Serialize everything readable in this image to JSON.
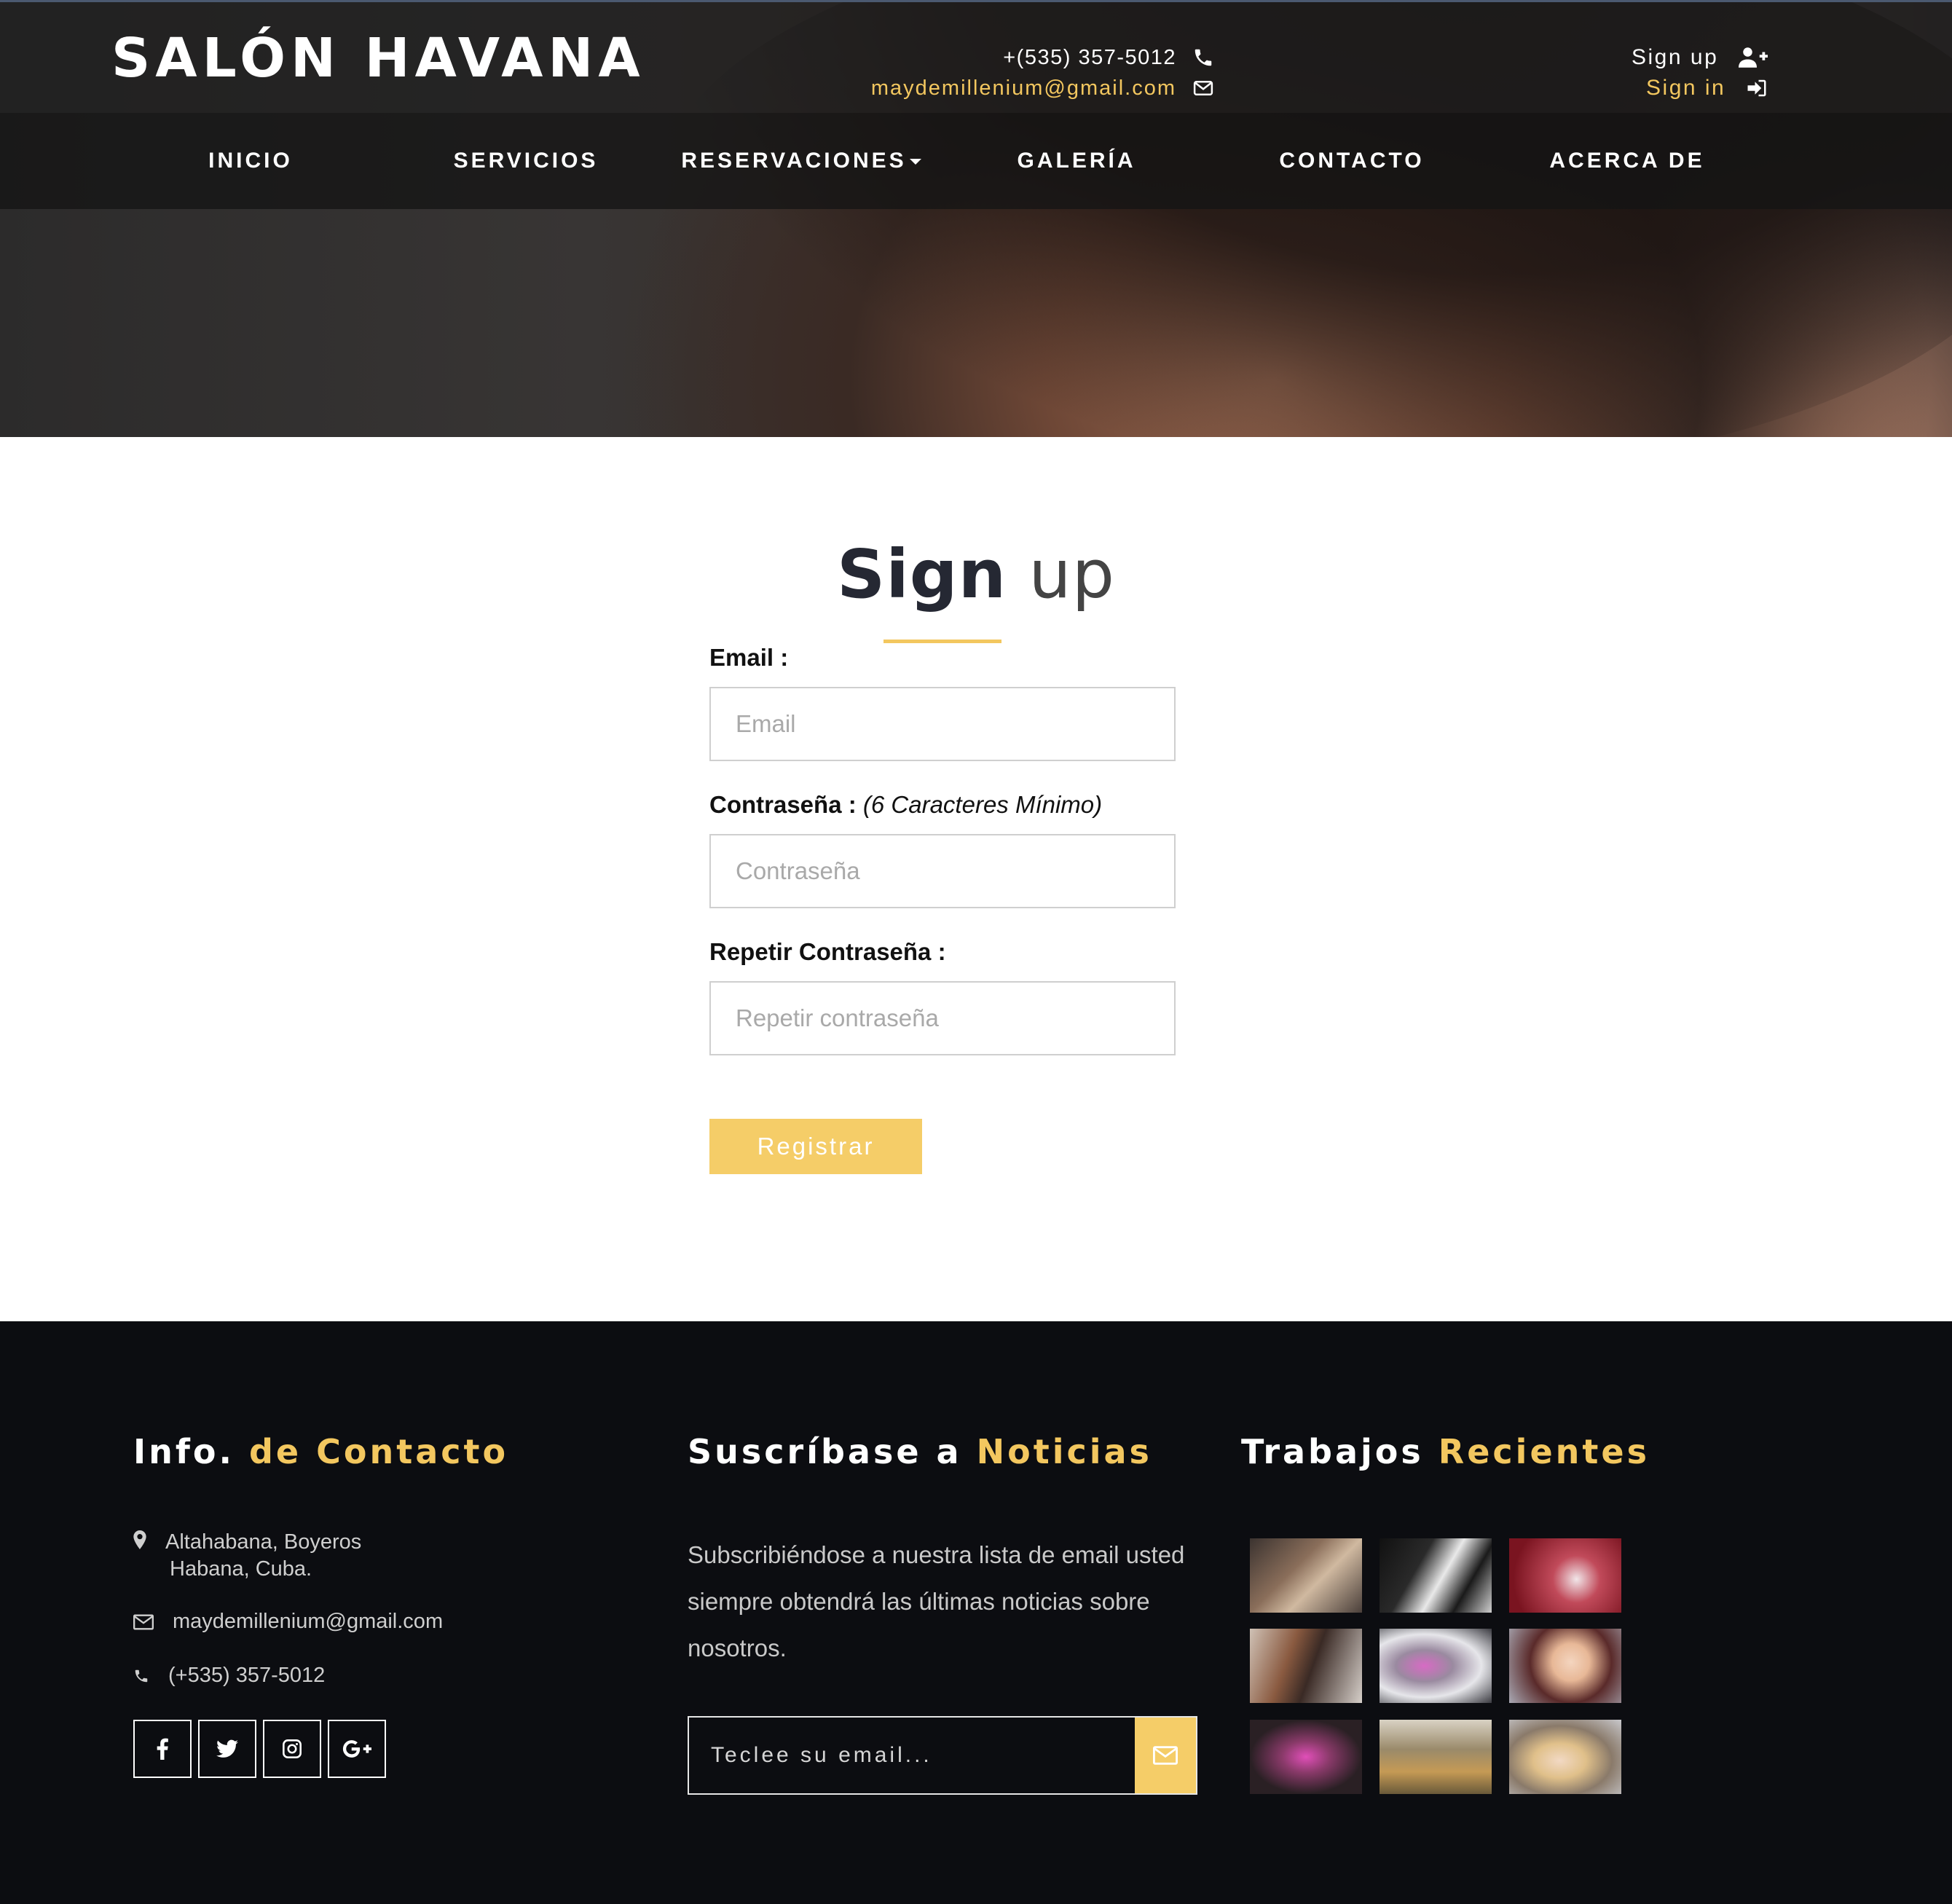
{
  "header": {
    "brand": "SALÓN HAVANA",
    "phone": "+(535) 357-5012",
    "email": "maydemillenium@gmail.com",
    "sign_up": "Sign up",
    "sign_in": "Sign in"
  },
  "nav": {
    "items": [
      "INICIO",
      "SERVICIOS",
      "RESERVACIONES",
      "GALERÍA",
      "CONTACTO",
      "ACERCA DE"
    ]
  },
  "signup": {
    "heading_bold": "Sign",
    "heading_light": "up",
    "email_label": "Email :",
    "email_placeholder": "Email",
    "password_label": "Contraseña :",
    "password_note": "(6 Caracteres Mínimo)",
    "password_placeholder": "Contraseña",
    "repeat_label": "Repetir Contraseña :",
    "repeat_placeholder": "Repetir contraseña",
    "submit_label": "Registrar"
  },
  "footer": {
    "contact": {
      "title_a": "Info.",
      "title_b": "de Contacto",
      "address_line1": "Altahabana, Boyeros",
      "address_line2": "Habana, Cuba.",
      "email": "maydemillenium@gmail.com",
      "phone": "(+535) 357-5012"
    },
    "newsletter": {
      "title_a": "Suscríbase a",
      "title_b": "Noticias",
      "description": "Subscribiéndose a nuestra lista de email usted siempre obtendrá las últimas noticias sobre nosotros.",
      "placeholder": "Teclee su email..."
    },
    "recent": {
      "title_a": "Trabajos",
      "title_b": "Recientes"
    }
  },
  "colors": {
    "accent": "#f3c75f",
    "footer_bg": "#0c0d11",
    "heading": "#252833"
  }
}
